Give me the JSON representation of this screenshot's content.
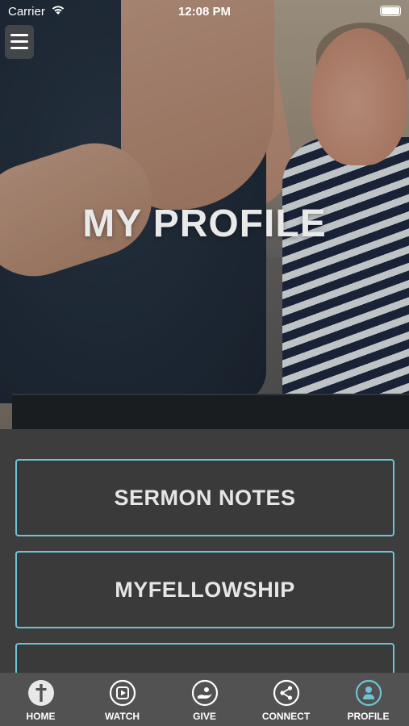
{
  "status_bar": {
    "carrier": "Carrier",
    "time": "12:08 PM"
  },
  "hero": {
    "title": "MY PROFILE",
    "menu_icon": "hamburger-menu-icon"
  },
  "cards": [
    {
      "label": "SERMON NOTES"
    },
    {
      "label": "MYFELLOWSHIP"
    },
    {
      "label": ""
    }
  ],
  "tabs": [
    {
      "label": "HOME",
      "icon": "cross-circle-icon"
    },
    {
      "label": "WATCH",
      "icon": "play-circle-icon"
    },
    {
      "label": "GIVE",
      "icon": "giving-hand-icon"
    },
    {
      "label": "CONNECT",
      "icon": "share-icon"
    },
    {
      "label": "PROFILE",
      "icon": "person-icon",
      "active": true
    }
  ],
  "colors": {
    "accent": "#6ec4d6",
    "background": "#3d3d3d",
    "tabbar": "#525252"
  }
}
